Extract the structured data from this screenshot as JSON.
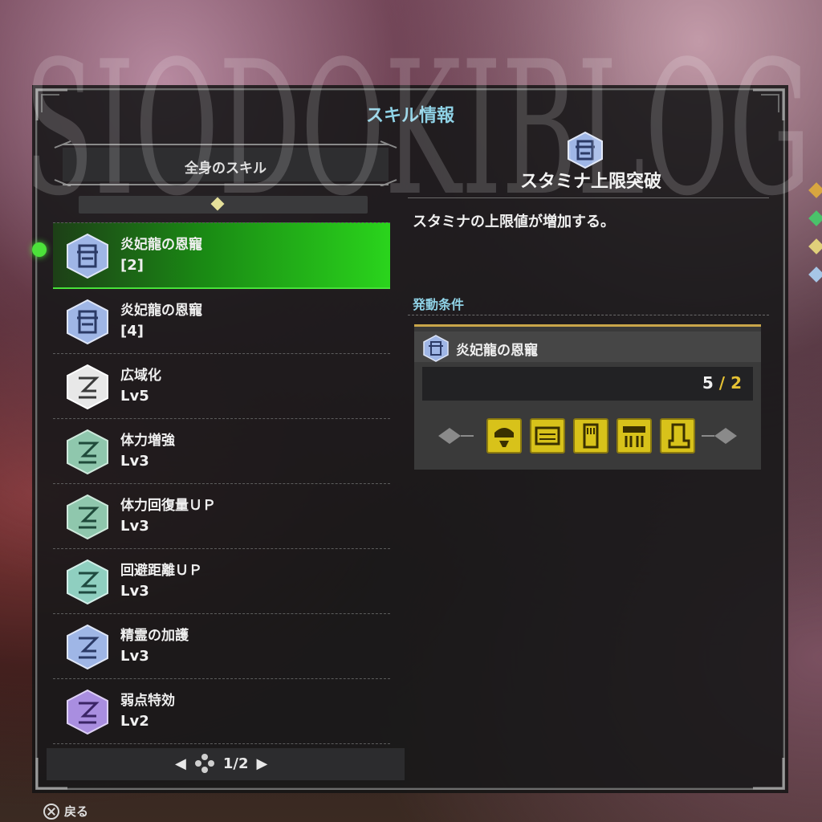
{
  "window": {
    "title": "スキル情報",
    "watermark_text": "SIODOKIBLOG"
  },
  "left_panel": {
    "header": "全身のスキル",
    "skills": [
      {
        "name": "炎妃龍の恩寵",
        "level": "[2]",
        "color": "#9fb6e6",
        "selected": true
      },
      {
        "name": "炎妃龍の恩寵",
        "level": "[4]",
        "color": "#9fb6e6",
        "selected": false
      },
      {
        "name": "広域化",
        "level": "Lv5",
        "color": "#e8e8e8",
        "selected": false
      },
      {
        "name": "体力増強",
        "level": "Lv3",
        "color": "#8fc7ad",
        "selected": false
      },
      {
        "name": "体力回復量ＵＰ",
        "level": "Lv3",
        "color": "#8fc7ad",
        "selected": false
      },
      {
        "name": "回避距離ＵＰ",
        "level": "Lv3",
        "color": "#8fcfc0",
        "selected": false
      },
      {
        "name": "精霊の加護",
        "level": "Lv3",
        "color": "#9fb6e6",
        "selected": false
      },
      {
        "name": "弱点特効",
        "level": "Lv2",
        "color": "#a98ee0",
        "selected": false
      }
    ],
    "pager": {
      "current": "1",
      "separator": "/",
      "total": "2",
      "text": "1/2"
    }
  },
  "right_panel": {
    "skill_title": "スタミナ上限突破",
    "description": "スタミナの上限値が増加する。",
    "condition_label": "発動条件",
    "condition": {
      "name": "炎妃龍の恩寵",
      "current": "5",
      "slash": "/",
      "required": "2"
    },
    "equipment_icons": [
      "helm-icon",
      "chest-icon",
      "arm-icon",
      "waist-icon",
      "leg-icon"
    ]
  },
  "footer": {
    "back_button_label": "戻る"
  },
  "colors": {
    "accent_cyan": "#8fd2e6",
    "selection_green": "#2ad41c",
    "equip_yellow": "#d8c21a",
    "gold_border": "#c9a64a"
  }
}
